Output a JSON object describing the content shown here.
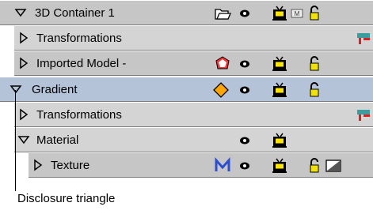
{
  "layers": [
    {
      "label": "3D Container 1",
      "depth": 0,
      "expanded": true,
      "icons": [
        "folder-open-icon",
        "eye-icon",
        "tv-icon",
        "m-badge-icon",
        "lock-icon"
      ]
    },
    {
      "label": "Transformations",
      "depth": 1,
      "expanded": false,
      "icons": [
        "transform-icon"
      ]
    },
    {
      "label": "Imported Model -",
      "depth": 1,
      "expanded": false,
      "icons": [
        "model-icon",
        "eye-icon",
        "tv-icon",
        "lock-icon"
      ]
    },
    {
      "label": "Gradient",
      "depth": 0,
      "expanded": true,
      "selected": true,
      "icons": [
        "diamond-icon",
        "eye-icon",
        "tv-icon",
        "lock-icon"
      ]
    },
    {
      "label": "Transformations",
      "depth": 1,
      "expanded": false,
      "icons": [
        "transform-icon"
      ]
    },
    {
      "label": "Material",
      "depth": 1,
      "expanded": true,
      "icons": [
        "eye-icon",
        "tv-icon"
      ]
    },
    {
      "label": "Texture",
      "depth": 2,
      "expanded": false,
      "icons": [
        "material-m-icon",
        "eye-icon",
        "tv-icon",
        "lock-icon",
        "swatch-icon"
      ]
    }
  ],
  "callout": {
    "text": "Disclosure triangle"
  },
  "colors": {
    "row_bg": "#c8c8c8",
    "selected_bg": "#b4c3d8",
    "child_bg": "#d6d6d6"
  }
}
